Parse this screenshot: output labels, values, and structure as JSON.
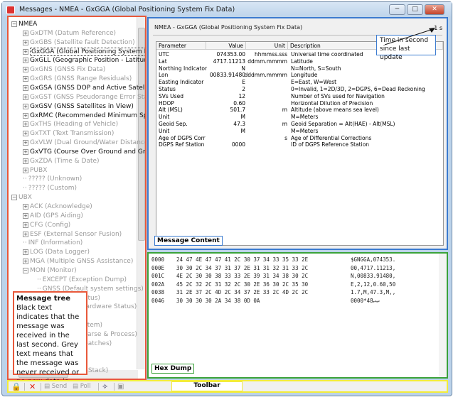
{
  "window": {
    "title": "Messages - NMEA - GxGGA (Global Positioning System Fix Data)"
  },
  "tree": {
    "items": [
      {
        "label": "NMEA",
        "level": 0,
        "expander": "minus",
        "received": true
      },
      {
        "label": "GxDTM (Datum Reference)",
        "level": 1,
        "expander": "plus",
        "received": false
      },
      {
        "label": "GxGBS (Satellite fault Detection)",
        "level": 1,
        "expander": "plus",
        "received": false
      },
      {
        "label": "GxGGA (Global Positioning System Fix Data)",
        "level": 1,
        "expander": "plus",
        "received": true,
        "selected": true
      },
      {
        "label": "GxGLL (Geographic Position - Latitude/Longitude)",
        "level": 1,
        "expander": "plus",
        "received": true
      },
      {
        "label": "GxGNS (GNSS Fix Data)",
        "level": 1,
        "expander": "plus",
        "received": false
      },
      {
        "label": "GxGRS (GNSS Range Residuals)",
        "level": 1,
        "expander": "plus",
        "received": false
      },
      {
        "label": "GxGSA (GNSS DOP and Active Satellites)",
        "level": 1,
        "expander": "plus",
        "received": true
      },
      {
        "label": "GxGST (GNSS Pseudorange Error Statistics)",
        "level": 1,
        "expander": "plus",
        "received": false
      },
      {
        "label": "GxGSV (GNSS Satellites in View)",
        "level": 1,
        "expander": "plus",
        "received": true
      },
      {
        "label": "GxRMC (Recommended Minimum Specific GNSS Data)",
        "level": 1,
        "expander": "plus",
        "received": true
      },
      {
        "label": "GxTHS (Heading of Vehicle)",
        "level": 1,
        "expander": "plus",
        "received": false
      },
      {
        "label": "GxTXT (Text Transmission)",
        "level": 1,
        "expander": "plus",
        "received": false
      },
      {
        "label": "GxVLW (Dual Ground/Water Distance)",
        "level": 1,
        "expander": "plus",
        "received": false
      },
      {
        "label": "GxVTG (Course Over Ground and Ground Speed)",
        "level": 1,
        "expander": "plus",
        "received": true
      },
      {
        "label": "GxZDA (Time & Date)",
        "level": 1,
        "expander": "plus",
        "received": false
      },
      {
        "label": "PUBX",
        "level": 1,
        "expander": "plus",
        "received": false
      },
      {
        "label": "????? (Unknown)",
        "level": 1,
        "expander": "none",
        "received": false
      },
      {
        "label": "????? (Custom)",
        "level": 1,
        "expander": "none",
        "received": false
      },
      {
        "label": "UBX",
        "level": 0,
        "expander": "minus",
        "received": false
      },
      {
        "label": "ACK (Acknowledge)",
        "level": 1,
        "expander": "plus",
        "received": false
      },
      {
        "label": "AID (GPS Aiding)",
        "level": 1,
        "expander": "plus",
        "received": false
      },
      {
        "label": "CFG (Config)",
        "level": 1,
        "expander": "plus",
        "received": false
      },
      {
        "label": "ESF (External Sensor Fusion)",
        "level": 1,
        "expander": "plus",
        "received": false
      },
      {
        "label": "INF (Information)",
        "level": 1,
        "expander": "none",
        "received": false
      },
      {
        "label": "LOG (Data Logger)",
        "level": 1,
        "expander": "plus",
        "received": false
      },
      {
        "label": "MGA (Multiple GNSS Assistance)",
        "level": 1,
        "expander": "plus",
        "received": false
      },
      {
        "label": "MON (Monitor)",
        "level": 1,
        "expander": "minus",
        "received": false
      },
      {
        "label": "EXCEPT (Exception Dump)",
        "level": 2,
        "expander": "none",
        "received": false
      },
      {
        "label": "GNSS (Default system settings)",
        "level": 2,
        "expander": "none",
        "received": false
      },
      {
        "label": "atus)",
        "level": 3,
        "expander": "none",
        "received": false
      },
      {
        "label": "lardware Status)",
        "level": 3,
        "expander": "none",
        "received": false
      },
      {
        "label": "",
        "level": 3,
        "expander": "none",
        "received": false
      },
      {
        "label": "stem)",
        "level": 3,
        "expander": "none",
        "received": false
      },
      {
        "label": "Parse & Process)",
        "level": 3,
        "expander": "none",
        "received": false
      },
      {
        "label": "patches)",
        "level": 3,
        "expander": "none",
        "received": false
      },
      {
        "label": ")",
        "level": 3,
        "expander": "none",
        "received": false
      },
      {
        "label": "",
        "level": 3,
        "expander": "none",
        "received": false
      },
      {
        "label": "/ Stack)",
        "level": 3,
        "expander": "none",
        "received": false
      }
    ],
    "callout": {
      "title": "Message tree",
      "text": "Black text indicates that the message was received in the last second. Grey text means that the message was never received or no new data is available."
    }
  },
  "content": {
    "header": "NMEA - GxGGA (Global Positioning System Fix Data)",
    "age": "1 s",
    "time_callout": "Time in second since last update",
    "columns": [
      "Parameter",
      "Value",
      "Unit",
      "Description"
    ],
    "rows": [
      [
        "UTC",
        "074353.00",
        "hhmmss.sss",
        "Universal time coordinated"
      ],
      [
        "Lat",
        "4717.11213",
        "ddmm.mmmm",
        "Latitude"
      ],
      [
        "Northing Indicator",
        "N",
        "",
        "N=North, S=South"
      ],
      [
        "Lon",
        "00833.91480",
        "dddmm.mmmm",
        "Longitude"
      ],
      [
        "Easting Indicator",
        "E",
        "",
        "E=East, W=West"
      ],
      [
        "Status",
        "2",
        "",
        "0=Invalid, 1=2D/3D, 2=DGPS, 6=Dead Reckoning"
      ],
      [
        "SVs Used",
        "12",
        "",
        "Number of SVs used for Navigation"
      ],
      [
        "HDOP",
        "0.60",
        "",
        "Horizontal Dilution of Precision"
      ],
      [
        "Alt (MSL)",
        "501.7",
        "m",
        "Altitude (above means sea level)"
      ],
      [
        "Unit",
        "M",
        "",
        "M=Meters"
      ],
      [
        "Geoid Sep.",
        "47.3",
        "m",
        "Geoid Separation = Alt(HAE) - Alt(MSL)"
      ],
      [
        "Unit",
        "M",
        "",
        "M=Meters"
      ],
      [
        "Age of DGPS Corr",
        "",
        "s",
        "Age of Differential Corrections"
      ],
      [
        "DGPS Ref Station",
        "0000",
        "",
        "ID of DGPS Reference Station"
      ]
    ],
    "label": "Message Content"
  },
  "hexdump": {
    "rows": [
      [
        "0000",
        "24 47 4E 47 47 41 2C 30 37 34 33 35 33 2E",
        "$GNGGA,074353."
      ],
      [
        "000E",
        "30 30 2C 34 37 31 37 2E 31 31 32 31 33 2C",
        "00,4717.11213,"
      ],
      [
        "001C",
        "4E 2C 30 30 38 33 33 2E 39 31 34 38 30 2C",
        "N,00833.91480,"
      ],
      [
        "002A",
        "45 2C 32 2C 31 32 2C 30 2E 36 30 2C 35 30",
        "E,2,12,0.60,50"
      ],
      [
        "0038",
        "31 2E 37 2C 4D 2C 34 37 2E 33 2C 4D 2C 2C",
        "1.7,M,47.3,M,,"
      ],
      [
        "0046",
        "30 30 30 30 2A 34 38 0D 0A",
        "0000*48↵↵"
      ]
    ],
    "label": "Hex Dump"
  },
  "toolbar": {
    "send": "Send",
    "poll": "Poll",
    "label": "Toolbar"
  },
  "colors": {
    "tree_border": "#e8583a",
    "content_border": "#3b7bd0",
    "hex_border": "#3aa23a",
    "toolbar_border": "#f3ec3b"
  }
}
